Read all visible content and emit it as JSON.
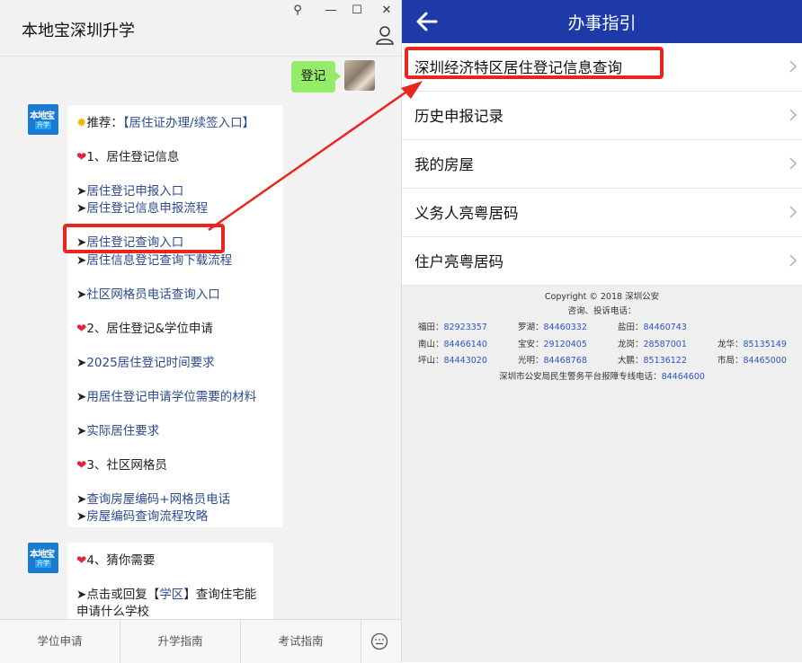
{
  "chat": {
    "title": "本地宝深圳升学",
    "window_buttons": [
      "⚲",
      "—",
      "☐",
      "✕"
    ],
    "my_message": "登记",
    "bot_avatar": {
      "line1": "本地宝",
      "line2": "升学"
    },
    "card1": {
      "header_icon": "sun-emoji",
      "header_prefix": "推荐：",
      "header_link": "【居住证办理/续签入口】",
      "section1": "1、居住登记信息",
      "link1": "居住登记申报入口",
      "link2": "居住登记信息申报流程",
      "link3": "居住登记查询入口",
      "link4": "居住信息登记查询下载流程",
      "link5": "社区网格员电话查询入口",
      "section2": "2、居住登记&学位申请",
      "link6": "2025居住登记时间要求",
      "link7": "用居住登记申请学位需要的材料",
      "link8": "实际居住要求",
      "section3": "3、社区网格员",
      "link9": "查询房屋编码+网格员电话",
      "link10": "房屋编码查询流程攻略"
    },
    "card2": {
      "section4": "4、猜你需要",
      "text_prefix": "点击或回复【",
      "text_link": "学区",
      "text_suffix": "】查询住宅能",
      "text_line2": "申请什么学校"
    },
    "footer_tabs": [
      "学位申请",
      "升学指南",
      "考试指南"
    ],
    "footer_icon": "keyboard-icon"
  },
  "guide": {
    "title": "办事指引",
    "items": [
      "深圳经济特区居住登记信息查询",
      "历史申报记录",
      "我的房屋",
      "义务人亮粤居码",
      "住户亮粤居码"
    ],
    "copyright": "Copyright © 2018 深圳公安",
    "hotline_label": "咨询、投诉电话：",
    "hotlines": [
      {
        "district": "福田：",
        "number": "82923357"
      },
      {
        "district": "罗湖：",
        "number": "84460332"
      },
      {
        "district": "盐田：",
        "number": "84460743"
      },
      {
        "district": "南山：",
        "number": "84466140"
      },
      {
        "district": "宝安：",
        "number": "29120405"
      },
      {
        "district": "龙岗：",
        "number": "28587001"
      },
      {
        "district": "龙华：",
        "number": "85135149"
      },
      {
        "district": "坪山：",
        "number": "84443020"
      },
      {
        "district": "光明：",
        "number": "84468768"
      },
      {
        "district": "大鹏：",
        "number": "85136122"
      },
      {
        "district": "市局：",
        "number": "84465000"
      }
    ],
    "platform_label": "深圳市公安局民生警务平台报障专线电话：",
    "platform_number": "84464600"
  },
  "colors": {
    "header_blue": "#1e3aa8",
    "highlight_red": "#e8261e",
    "bubble_green": "#95ec69",
    "link_blue": "#2e4b8f"
  }
}
